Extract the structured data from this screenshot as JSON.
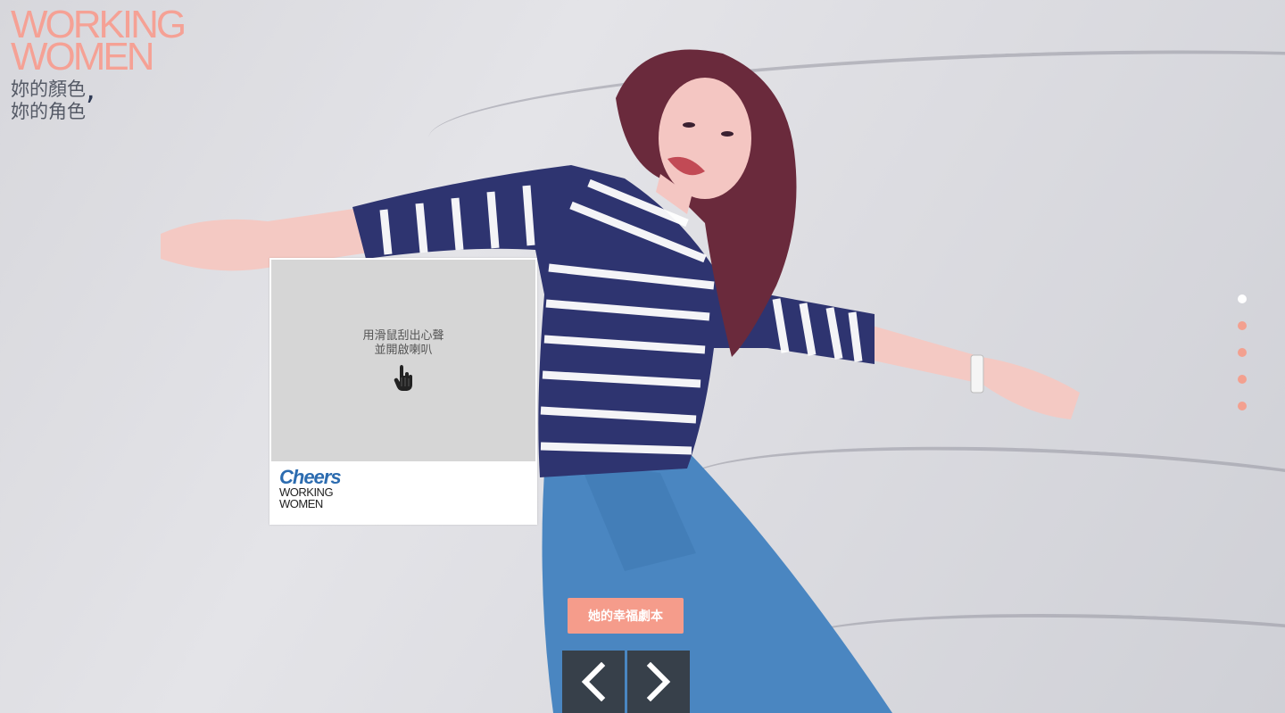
{
  "header": {
    "logo_line1": "WORKING",
    "logo_line2": "WOMEN",
    "tagline_line1": "妳的顏色",
    "tagline_line2": "妳的角色",
    "tagline_comma": ","
  },
  "scratch_card": {
    "instruction_line1": "用滑鼠刮出心聲",
    "instruction_line2": "並開啟喇叭",
    "icon": "pointer-hand-icon",
    "brand_line1": "Cheers",
    "brand_line2": "WORKING",
    "brand_line3": "WOMEN"
  },
  "pagination": {
    "count": 5,
    "active_index": 0,
    "active_color": "#ffffff",
    "inactive_color": "#f3a08f"
  },
  "story_button": {
    "label": "她的幸福劇本"
  },
  "navigation": {
    "prev_icon": "chevron-left-icon",
    "next_icon": "chevron-right-icon"
  },
  "colors": {
    "accent": "#f59c8b",
    "logo": "#f5a195",
    "nav_bg": "#37404a",
    "brand_blue": "#2c6cb0"
  }
}
